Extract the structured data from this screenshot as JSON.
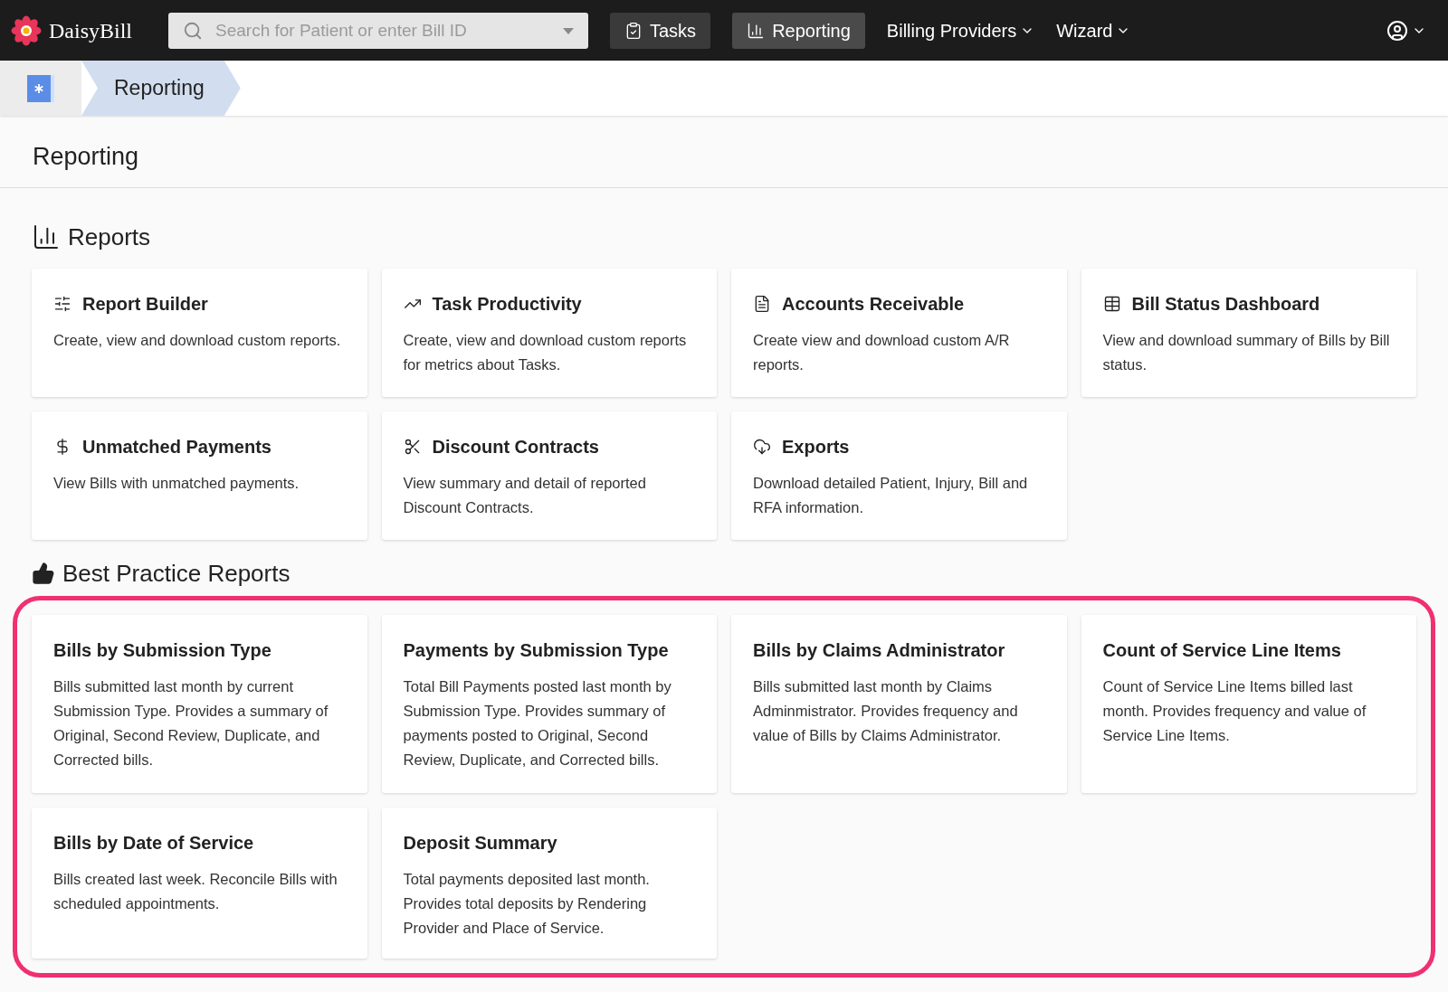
{
  "app": {
    "name": "DaisyBill"
  },
  "search": {
    "placeholder": "Search for Patient or enter Bill ID"
  },
  "nav": [
    {
      "label": "Tasks",
      "selected": false,
      "kind": "button"
    },
    {
      "label": "Reporting",
      "selected": true,
      "kind": "button"
    },
    {
      "label": "Billing Providers",
      "selected": false,
      "kind": "menu"
    },
    {
      "label": "Wizard",
      "selected": false,
      "kind": "menu"
    }
  ],
  "breadcrumb": {
    "current": "Reporting"
  },
  "page_title": "Reporting",
  "reports": {
    "title": "Reports",
    "cards": [
      {
        "title": "Report Builder",
        "description": "Create, view and download custom reports."
      },
      {
        "title": "Task Productivity",
        "description": "Create, view and download custom reports for metrics about Tasks."
      },
      {
        "title": "Accounts Receivable",
        "description": "Create view and download custom A/R reports."
      },
      {
        "title": "Bill Status Dashboard",
        "description": "View and download summary of Bills by Bill status."
      },
      {
        "title": "Unmatched Payments",
        "description": "View Bills with unmatched payments."
      },
      {
        "title": "Discount Contracts",
        "description": "View summary and detail of reported Discount Contracts."
      },
      {
        "title": "Exports",
        "description": "Download detailed Patient, Injury, Bill and RFA information."
      }
    ]
  },
  "best_practice": {
    "title": "Best Practice Reports",
    "highlighted": true,
    "cards": [
      {
        "title": "Bills by Submission Type",
        "description": "Bills submitted last month by current Submission Type. Provides a summary of Original, Second Review, Duplicate, and Corrected bills."
      },
      {
        "title": "Payments by Submission Type",
        "description": "Total Bill Payments posted last month by Submission Type. Provides summary of payments posted to Original, Second Review, Duplicate, and Corrected bills."
      },
      {
        "title": "Bills by Claims Administrator",
        "description": "Bills submitted last month by Claims Adminmistrator. Provides frequency and value of Bills by Claims Administrator."
      },
      {
        "title": "Count of Service Line Items",
        "description": "Count of Service Line Items billed last month. Provides frequency and value of Service Line Items."
      },
      {
        "title": "Bills by Date of Service",
        "description": "Bills created last week. Reconcile Bills with scheduled appointments."
      },
      {
        "title": "Deposit Summary",
        "description": "Total payments deposited last month. Provides total deposits by Rendering Provider and Place of Service."
      }
    ]
  }
}
